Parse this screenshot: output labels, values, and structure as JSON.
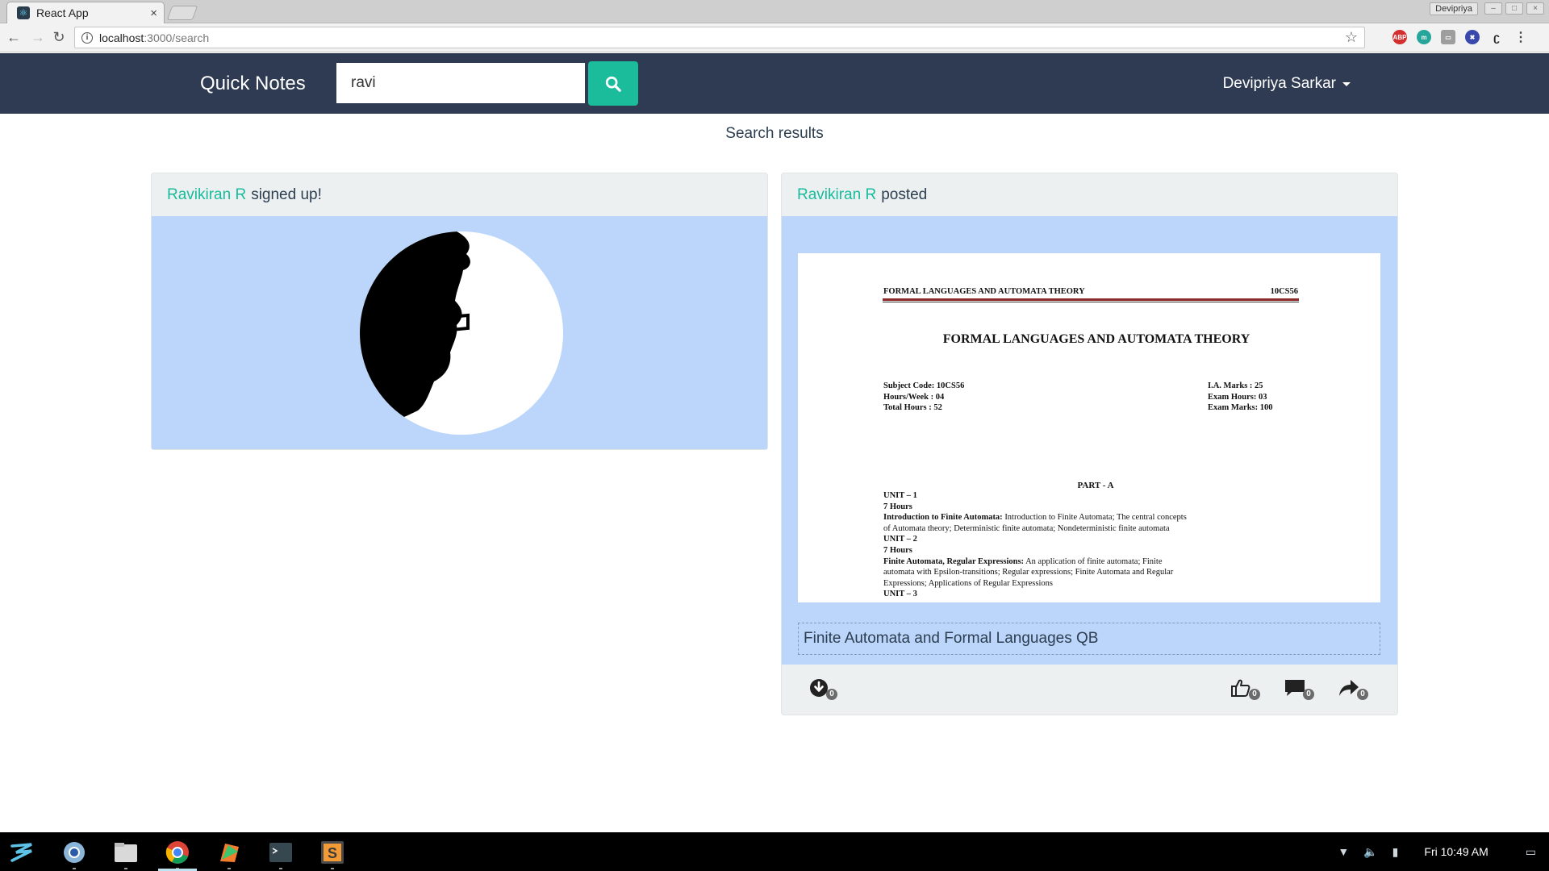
{
  "browser": {
    "tab_title": "React App",
    "tab_close": "×",
    "profile_name": "Devipriya",
    "url_host": "localhost",
    "url_rest": ":3000/search"
  },
  "navbar": {
    "brand": "Quick Notes",
    "search_value": "ravi",
    "user_name": "Devipriya Sarkar"
  },
  "page": {
    "results_heading": "Search results"
  },
  "cards": [
    {
      "user": "Ravikiran R",
      "action_text": "signed up!"
    },
    {
      "user": "Ravikiran R",
      "action_text": "posted",
      "note_title": "Finite Automata and Formal Languages QB",
      "preview": {
        "header_left": "FORMAL LANGUAGES AND AUTOMATA THEORY",
        "header_right": "10CS56",
        "title": "FORMAL LANGUAGES AND AUTOMATA THEORY",
        "meta_left": [
          "Subject Code: 10CS56",
          "Hours/Week : 04",
          "Total Hours : 52"
        ],
        "meta_right": [
          "I.A. Marks : 25",
          "Exam Hours: 03",
          "Exam Marks: 100"
        ],
        "part": "PART - A",
        "unit1": "UNIT – 1",
        "unit1_hours": "7 Hours",
        "unit1_topic": "Introduction to Finite Automata:",
        "unit1_text": "Introduction to Finite Automata; The central concepts of Automata theory; Deterministic finite automata; Nondeterministic finite automata",
        "unit2": "UNIT – 2",
        "unit2_hours": "7 Hours",
        "unit2_topic": "Finite Automata, Regular Expressions:",
        "unit2_text": "An application of finite automata; Finite automata with Epsilon-transitions; Regular expressions; Finite Automata and Regular Expressions; Applications of Regular Expressions",
        "unit3_partial": "UNIT – 3"
      },
      "downloads": "0",
      "likes": "0",
      "comments": "0",
      "shares": "0"
    }
  ],
  "taskbar": {
    "clock": "Fri 10:49 AM"
  },
  "colors": {
    "navbar_bg": "#2f3b52",
    "accent": "#1abc9c",
    "card_body": "#bcd6fb",
    "card_bg": "#ecf0f1"
  }
}
